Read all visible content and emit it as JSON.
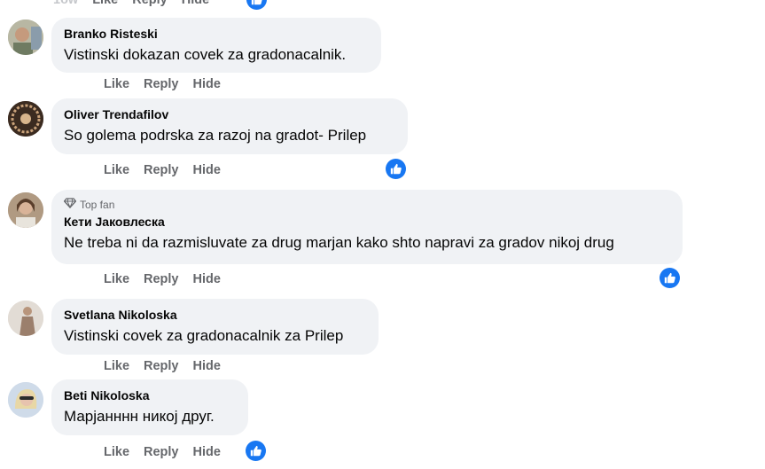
{
  "actions": {
    "like": "Like",
    "reply": "Reply",
    "hide": "Hide"
  },
  "comments": [
    {
      "author": "Branko Risteski",
      "text": "Vistinski dokazan covek za gradonacalnik.",
      "top_fan": false,
      "liked_reaction": false
    },
    {
      "author": "Oliver Trendafilov",
      "text": "So golema podrska za razoj na gradot- Prilep",
      "top_fan": false,
      "liked_reaction": true
    },
    {
      "author": "Кети Јаковлеска",
      "text": "Ne treba ni da razmisluvate za drug marjan kako shto napravi za gradov nikoj drug",
      "top_fan": true,
      "badge": "Top fan",
      "liked_reaction": true
    },
    {
      "author": "Svetlana Nikoloska",
      "text": "Vistinski covek za gradonacalnik za Prilep",
      "top_fan": false,
      "liked_reaction": false
    },
    {
      "author": "Beti Nikoloska",
      "text": "Марјанннн никој друг.",
      "top_fan": false,
      "liked_reaction": true
    }
  ],
  "colors": {
    "bubble": "#f0f2f5",
    "action_text": "#65676b",
    "like_blue": "#1877f2"
  },
  "icons": {
    "like_reaction": "thumbs-up-icon",
    "top_fan_badge": "diamond-icon"
  }
}
